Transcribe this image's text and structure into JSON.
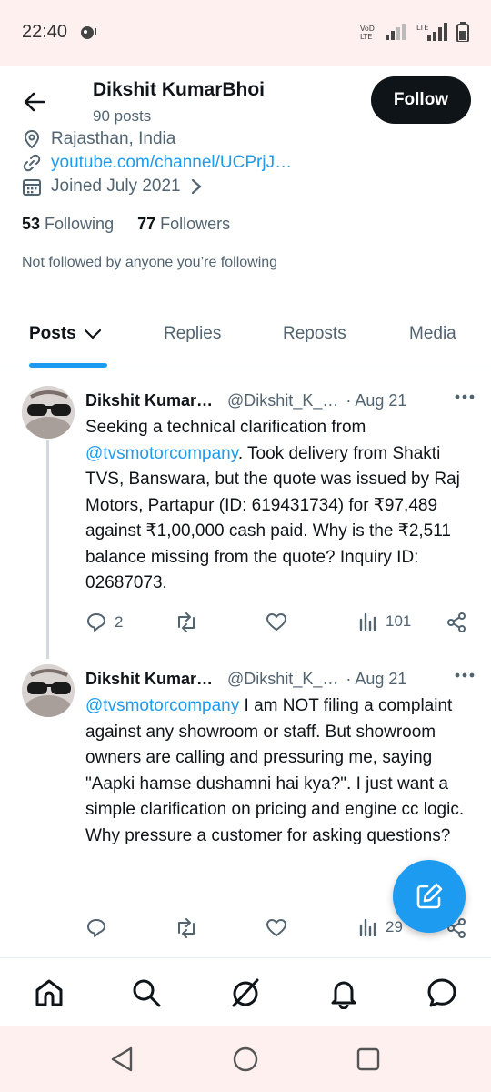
{
  "status_bar": {
    "time": "22:40",
    "network_label": "Vo) LTE1",
    "lte_label": "LTE"
  },
  "header": {
    "back_icon": "arrow-left-icon",
    "name": "Dikshit KumarBhoi",
    "posts_count": "90 posts",
    "follow_label": "Follow"
  },
  "profile": {
    "location": "Rajasthan, India",
    "link": "youtube.com/channel/UCPrjJ…",
    "joined": "Joined July 2021",
    "following_count": "53",
    "following_label": "Following",
    "followers_count": "77",
    "followers_label": "Followers",
    "not_followed": "Not followed by anyone you’re following"
  },
  "tabs": [
    {
      "label": "Posts"
    },
    {
      "label": "Replies"
    },
    {
      "label": "Reposts"
    },
    {
      "label": "Media"
    }
  ],
  "tweets": [
    {
      "name": "Dikshit Kumar…",
      "handle": "@Dikshit_K_…",
      "date": "· Aug 21",
      "mention": "@tvsmotorcompany",
      "text_before": "Seeking a technical clarification from ",
      "text_after": ". Took delivery from Shakti TVS, Banswara, but the quote was issued by Raj Motors, Partapur (ID: 619431734) for ₹97,489 against ₹1,00,000 cash paid. Why is the ₹2,511 balance missing from the quote? Inquiry ID: 02687073.",
      "replies": "2",
      "reposts": "",
      "likes": "",
      "views": "101"
    },
    {
      "name": "Dikshit Kumar…",
      "handle": "@Dikshit_K_…",
      "date": "· Aug 21",
      "mention": "@tvsmotorcompany",
      "text_before": "",
      "text_after": " I am NOT filing a complaint against any showroom or staff. But showroom owners are calling and pressuring me, saying \"Aapki hamse dushamni hai kya?\". I just want a simple clarification on pricing and engine cc logic. Why pressure a customer for asking questions?",
      "replies": "",
      "reposts": "",
      "likes": "",
      "views": "29"
    }
  ],
  "colors": {
    "accent": "#1d9bf0",
    "text": "#0f1419",
    "secondary": "#536471",
    "status_bg": "#fdf0ef"
  },
  "bottom_nav": [
    "home-icon",
    "search-icon",
    "grok-icon",
    "notifications-icon",
    "messages-icon"
  ],
  "system_nav": [
    "back-triangle-icon",
    "home-circle-icon",
    "recents-square-icon"
  ]
}
